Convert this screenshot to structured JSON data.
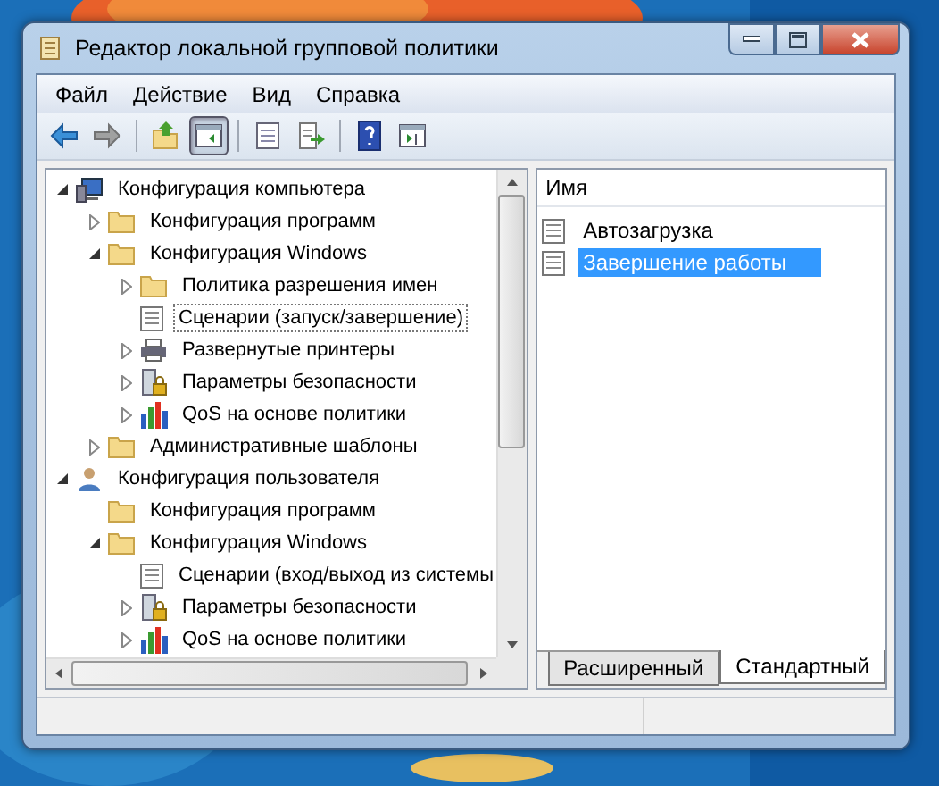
{
  "window": {
    "title": "Редактор локальной групповой политики"
  },
  "menu": [
    "Файл",
    "Действие",
    "Вид",
    "Справка"
  ],
  "toolbar": [
    {
      "kind": "back",
      "disabled": false,
      "pressed": false
    },
    {
      "kind": "forward",
      "disabled": true,
      "pressed": false
    },
    {
      "kind": "sep"
    },
    {
      "kind": "up",
      "disabled": false,
      "pressed": false
    },
    {
      "kind": "tree",
      "disabled": false,
      "pressed": true
    },
    {
      "kind": "sep"
    },
    {
      "kind": "properties",
      "disabled": false,
      "pressed": false
    },
    {
      "kind": "export",
      "disabled": false,
      "pressed": false
    },
    {
      "kind": "sep"
    },
    {
      "kind": "help",
      "disabled": false,
      "pressed": false
    },
    {
      "kind": "actions",
      "disabled": false,
      "pressed": false
    }
  ],
  "tree": [
    {
      "label": "Конфигурация компьютера",
      "kind": "computer",
      "expanded": true,
      "selected": false,
      "children": [
        {
          "label": "Конфигурация программ",
          "kind": "folder",
          "expanded": false,
          "selected": false
        },
        {
          "label": "Конфигурация Windows",
          "kind": "folder",
          "expanded": true,
          "selected": false,
          "children": [
            {
              "label": "Политика разрешения имен",
              "kind": "folder",
              "expanded": false,
              "selected": false
            },
            {
              "label": "Сценарии (запуск/завершение)",
              "kind": "script",
              "selected": true
            },
            {
              "label": "Развернутые принтеры",
              "kind": "printer",
              "expanded": false,
              "selected": false
            },
            {
              "label": "Параметры безопасности",
              "kind": "security",
              "expanded": false,
              "selected": false
            },
            {
              "label": "QoS на основе политики",
              "kind": "qos",
              "expanded": false,
              "selected": false
            }
          ]
        },
        {
          "label": "Административные шаблоны",
          "kind": "folder",
          "expanded": false,
          "selected": false
        }
      ]
    },
    {
      "label": "Конфигурация пользователя",
      "kind": "user",
      "expanded": true,
      "selected": false,
      "children": [
        {
          "label": "Конфигурация программ",
          "kind": "folder",
          "selected": false
        },
        {
          "label": "Конфигурация Windows",
          "kind": "folder",
          "expanded": true,
          "selected": false,
          "children": [
            {
              "label": "Сценарии (вход/выход из системы",
              "kind": "script",
              "selected": false
            },
            {
              "label": "Параметры безопасности",
              "kind": "security",
              "expanded": false,
              "selected": false
            },
            {
              "label": "QoS на основе политики",
              "kind": "qos",
              "expanded": false,
              "selected": false
            }
          ]
        }
      ]
    }
  ],
  "list": {
    "column": "Имя",
    "items": [
      {
        "label": "Автозагрузка",
        "selected": false
      },
      {
        "label": "Завершение работы",
        "selected": true
      }
    ]
  },
  "tabs": [
    {
      "label": "Расширенный",
      "selected": false
    },
    {
      "label": "Стандартный",
      "selected": true
    }
  ]
}
